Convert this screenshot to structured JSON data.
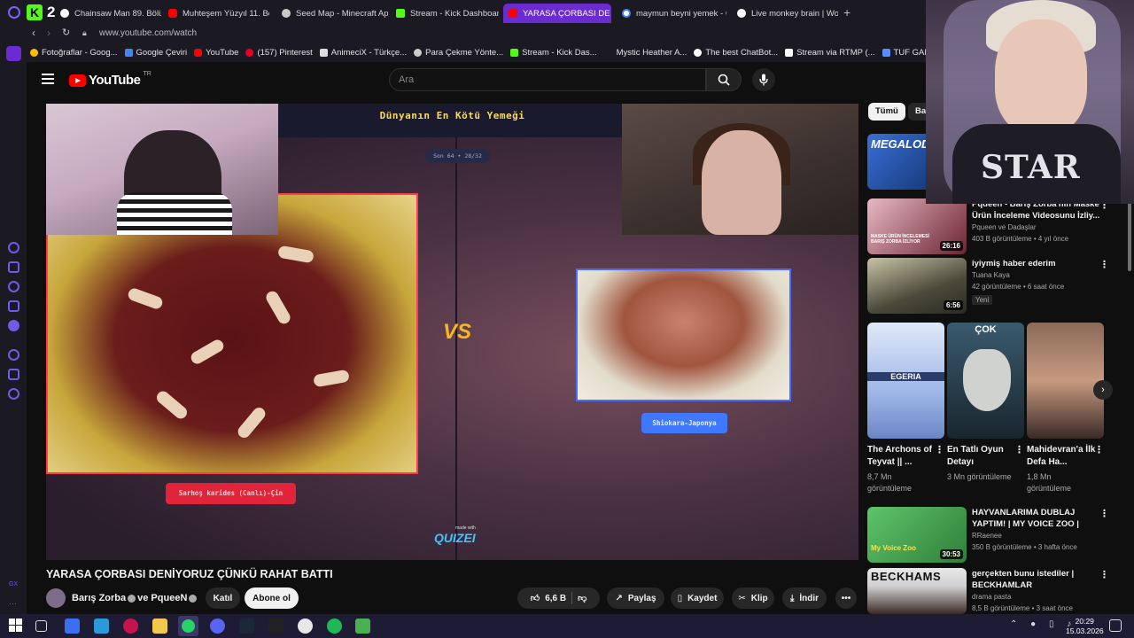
{
  "browser": {
    "tabs": [
      {
        "label": "Chainsaw Man 89. Bölüm",
        "icon": "moon-icon"
      },
      {
        "label": "Muhteşem Yüzyıl 11. Bölüm",
        "icon": "youtube-icon"
      },
      {
        "label": "Seed Map - Minecraft App",
        "icon": "seed-icon"
      },
      {
        "label": "Stream - Kick Dashboard",
        "icon": "kick-icon"
      },
      {
        "label": "YARASA ÇORBASI DE",
        "icon": "youtube-icon",
        "active": true
      },
      {
        "label": "maymun beyni yemek - G",
        "icon": "google-icon"
      },
      {
        "label": "Live monkey brain | World",
        "icon": "moon-icon"
      }
    ],
    "url": "www.youtube.com/watch",
    "bookmarks": [
      {
        "label": "Fotoğraflar - Goog...",
        "icon": "photos-icon"
      },
      {
        "label": "Google Çeviri",
        "icon": "translate-icon"
      },
      {
        "label": "YouTube",
        "icon": "youtube-icon"
      },
      {
        "label": "(157) Pinterest",
        "icon": "pinterest-icon"
      },
      {
        "label": "AnimeciX - Türkçe...",
        "icon": "animecix-icon"
      },
      {
        "label": "Para Çekme Yönte...",
        "icon": "money-icon"
      },
      {
        "label": "Stream - Kick Das...",
        "icon": "kick-icon"
      },
      {
        "label": "Mystic Heather A...",
        "icon": "none"
      },
      {
        "label": "The best ChatBot...",
        "icon": "chatbot-icon"
      },
      {
        "label": "Stream via RTMP (...",
        "icon": "rtmp-icon"
      },
      {
        "label": "TUF GAMING B6",
        "icon": "tuf-icon"
      }
    ]
  },
  "youtube": {
    "logo_text": "YouTube",
    "region": "TR",
    "search_placeholder": "Ara"
  },
  "video": {
    "quiz_title": "Dünyanın En Kötü Yemeği",
    "round": "Son 64 • 28/32",
    "left_label": "Sarhoş karides (Canlı)-Çin",
    "right_label": "Shiokara-Japonya",
    "vs": "VS",
    "made_with": "made with",
    "quizei": "QUIZEI",
    "title": "YARASA ÇORBASI DENİYORUZ ÇÜNKÜ RAHAT BATTI",
    "channel": "Barış Zorba",
    "collab": "ve PqueeN",
    "join_label": "Katıl",
    "subscribe_label": "Abone ol",
    "likes": "6,6 B",
    "share_label": "Paylaş",
    "save_label": "Kaydet",
    "clip_label": "Klip",
    "download_label": "İndir"
  },
  "sidebar": {
    "chips": [
      "Tümü",
      "Bar"
    ],
    "recs": [
      {
        "title": "MEGALODON...",
        "channel": "",
        "stats": "",
        "duration": ""
      },
      {
        "title": "Pqueen - Barış Zorba'nın Maske Ürün İnceleme Videosunu İzliy...",
        "channel": "Pqueen ve Dadaşlar",
        "stats": "403 B görüntüleme • 4 yıl önce",
        "duration": "26:16"
      },
      {
        "title": "iyiymiş haber ederim",
        "channel": "Tuana Kaya",
        "stats": "42 görüntüleme • 6 saat önce",
        "duration": "6:56",
        "badge": "Yeni"
      },
      {
        "title": "HAYVANLARIMA DUBLAJ YAPTIM! | MY VOICE ZOO |",
        "channel": "RRaenee",
        "stats": "350 B görüntüleme • 3 hafta önce",
        "duration": "30:53"
      },
      {
        "title": "gerçekten bunu istediler | BECKHAMLAR",
        "channel": "drama pasta",
        "stats": "8,5 B görüntüleme • 3 saat önce",
        "duration": ""
      }
    ],
    "shorts": [
      {
        "title": "The Archons of Teyvat || ...",
        "views": "8,7 Mn görüntüleme",
        "thumb_text": "EGERIA"
      },
      {
        "title": "En Tatlı Oyun Detayı",
        "views": "3 Mn görüntüleme",
        "thumb_text": "ÇOK"
      },
      {
        "title": "Mahidevran'a İlk Defa Ha...",
        "views": "1,8 Mn görüntüleme",
        "thumb_text": ""
      }
    ],
    "thumb_texts": {
      "rec1": "MASKE ÜRÜN İNCELEMESİ BARIŞ ZORBA İZLİYOR",
      "myvoicezoo": "My Voice Zoo",
      "beckhams": "BECKHAMS"
    }
  },
  "webcam": {
    "shirt_text": "STAR"
  },
  "taskbar": {
    "time": "20:29",
    "date": "15.03.2026"
  },
  "colors": {
    "accent": "#6a2bd1",
    "yt_red": "#ff0000",
    "label_left": "#e2243a",
    "label_right": "#3f78ff",
    "quiz_title": "#ffd95a"
  }
}
